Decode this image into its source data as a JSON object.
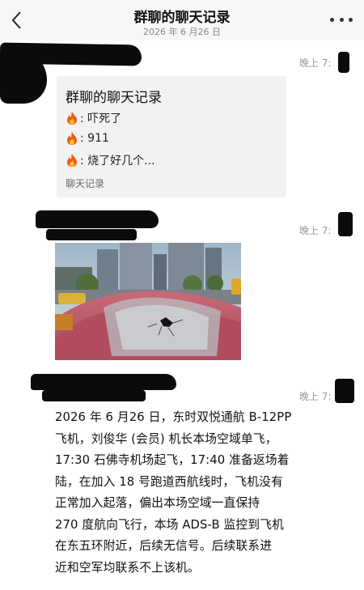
{
  "header": {
    "title": "群聊的聊天记录",
    "date": "2026 年 6 月26 日"
  },
  "messages": [
    {
      "time": "晚上 7:",
      "card": {
        "title": "群聊的聊天记录",
        "lines": [
          ": 吓死了",
          ": 911",
          ": 烧了好几个..."
        ],
        "footer": "聊天记录"
      }
    },
    {
      "time": "晚上 7:"
    },
    {
      "time": "晚上 7:",
      "text_lines": [
        "2026 年 6 月26 日，东时双悦通航 B-12PP",
        "飞机，刘俊华 (会员) 机长本场空域单飞，",
        "17:30 石佛寺机场起飞，17:40 准备返场着",
        "陆，在加入 18 号跑道西航线时，飞机没有",
        "正常加入起落，偏出本场空域一直保持",
        "270 度航向飞行，本场 ADS-B 监控到飞机",
        "在东五环附近，后续无信号。后续联系进",
        "近和空军均联系不上该机。"
      ]
    }
  ],
  "colors": {
    "header_bg": "#f7f7f7",
    "card_bg": "#f2f2f2",
    "redaction": "#0b0b0b",
    "time_text": "#9a9a9a"
  }
}
